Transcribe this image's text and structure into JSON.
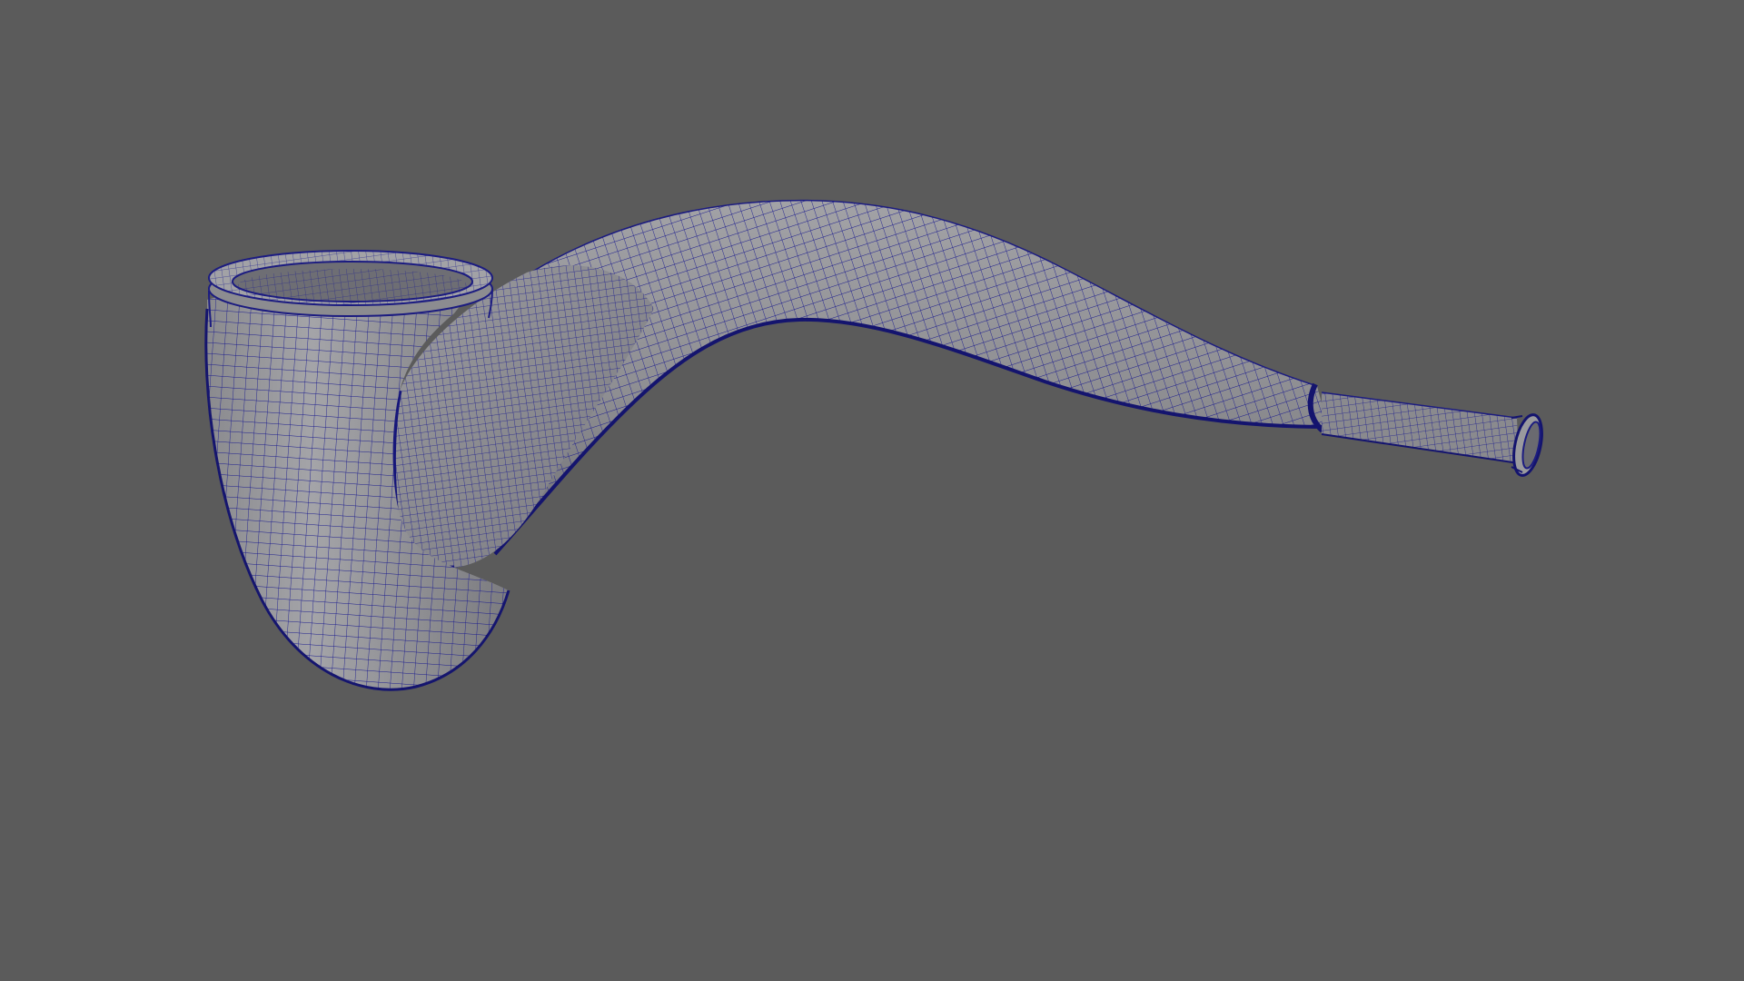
{
  "viewport": {
    "background_color": "#5b5b5b",
    "object": "smoking-pipe-mesh",
    "display_mode": "wireframe-on-shaded",
    "surface_color": "#8e8e92",
    "wire_color": "#1a1a8c"
  }
}
